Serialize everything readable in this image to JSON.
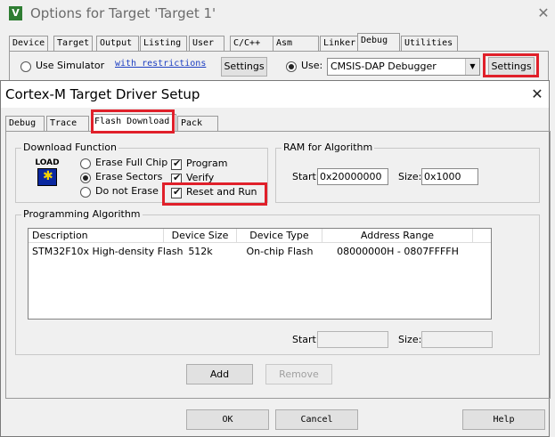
{
  "parent": {
    "title": "Options for Target 'Target 1'",
    "app_icon_glyph": "V",
    "close_glyph": "✕",
    "tabs": [
      "Device",
      "Target",
      "Output",
      "Listing",
      "User",
      "C/C++",
      "Asm",
      "Linker",
      "Debug",
      "Utilities"
    ],
    "active_tab": "Debug",
    "use_simulator_label": "Use Simulator",
    "restrictions_link": "with restrictions",
    "settings_label": "Settings",
    "use_label": "Use:",
    "debugger_value": "CMSIS-DAP Debugger",
    "use_simulator_selected": false,
    "use_debugger_selected": true
  },
  "dialog": {
    "title": "Cortex-M Target Driver Setup",
    "close_glyph": "✕",
    "tabs": [
      "Debug",
      "Trace",
      "Flash Download",
      "Pack"
    ],
    "active_tab": "Flash Download",
    "download_function": {
      "label": "Download Function",
      "icon_text": "LOAD",
      "erase_full_chip": "Erase Full Chip",
      "erase_sectors": "Erase Sectors",
      "do_not_erase": "Do not Erase",
      "selected_erase": "Erase Sectors",
      "program": "Program",
      "verify": "Verify",
      "reset_and_run": "Reset and Run",
      "program_checked": true,
      "verify_checked": true,
      "reset_and_run_checked": true
    },
    "ram": {
      "label": "RAM for Algorithm",
      "start_label": "Start:",
      "start_value": "0x20000000",
      "size_label": "Size:",
      "size_value": "0x1000"
    },
    "programming": {
      "label": "Programming Algorithm",
      "columns": [
        "Description",
        "Device Size",
        "Device Type",
        "Address Range"
      ],
      "rows": [
        {
          "description": "STM32F10x High-density Flash",
          "device_size": "512k",
          "device_type": "On-chip Flash",
          "address_range": "08000000H - 0807FFFFH"
        }
      ],
      "start_label": "Start:",
      "size_label": "Size:",
      "add_label": "Add",
      "remove_label": "Remove"
    },
    "buttons": {
      "ok": "OK",
      "cancel": "Cancel",
      "help": "Help"
    }
  },
  "colors": {
    "highlight_box": "#e0202a",
    "link": "#1d3fc2"
  }
}
